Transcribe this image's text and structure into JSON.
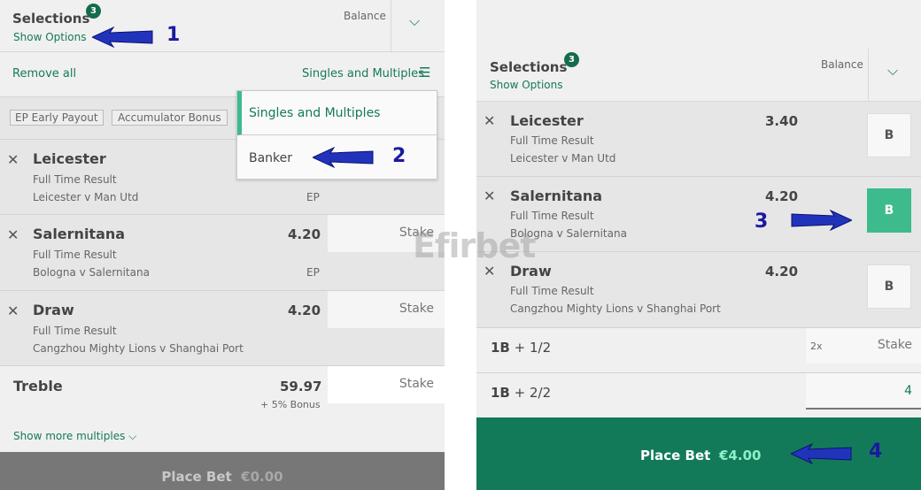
{
  "left": {
    "header": {
      "title": "Selections",
      "badge": "3",
      "show_options": "Show Options",
      "balance": "Balance"
    },
    "toolbar": {
      "remove_all": "Remove all",
      "mode": "Singles and Multiples"
    },
    "tags": [
      "EP  Early Payout",
      "Accumulator Bonus"
    ],
    "dropdown": {
      "options": [
        "Singles and Multiples",
        "Banker"
      ]
    },
    "selections": [
      {
        "name": "Leicester",
        "market": "Full Time Result",
        "event": "Leicester v Man Utd",
        "ep": "EP",
        "odds": ""
      },
      {
        "name": "Salernitana",
        "market": "Full Time Result",
        "event": "Bologna v Salernitana",
        "ep": "EP",
        "odds": "4.20",
        "stake": "Stake"
      },
      {
        "name": "Draw",
        "market": "Full Time Result",
        "event": "Cangzhou Mighty Lions v Shanghai Port",
        "odds": "4.20",
        "stake": "Stake"
      }
    ],
    "treble": {
      "label": "Treble",
      "odds": "59.97",
      "bonus": "+ 5% Bonus",
      "stake": "Stake"
    },
    "show_more": "Show more multiples",
    "place_bet": {
      "label": "Place Bet",
      "amount": "€0.00"
    }
  },
  "right": {
    "header": {
      "title": "Selections",
      "badge": "3",
      "show_options": "Show Options",
      "balance": "Balance"
    },
    "selections": [
      {
        "name": "Leicester",
        "market": "Full Time Result",
        "event": "Leicester v Man Utd",
        "odds": "3.40",
        "banker": "B",
        "active": false
      },
      {
        "name": "Salernitana",
        "market": "Full Time Result",
        "event": "Bologna v Salernitana",
        "odds": "4.20",
        "banker": "B",
        "active": true
      },
      {
        "name": "Draw",
        "market": "Full Time Result",
        "event": "Cangzhou Mighty Lions v Shanghai Port",
        "odds": "4.20",
        "banker": "B",
        "active": false
      }
    ],
    "bets": [
      {
        "label_bold": "1B",
        "label": "+ 1/2",
        "multiplier": "2x",
        "stake": "Stake"
      },
      {
        "label_bold": "1B",
        "label": "+ 2/2",
        "value": "4"
      }
    ],
    "place_bet": {
      "label": "Place Bet",
      "amount": "€4.00"
    }
  },
  "annotations": [
    "1",
    "2",
    "3",
    "4"
  ],
  "watermark": "Efirbet",
  "colors": {
    "brand_green": "#157a57",
    "place_bet_active": "#137a59",
    "banker_active": "#3dbb8c",
    "place_bet_disabled": "#777777"
  }
}
